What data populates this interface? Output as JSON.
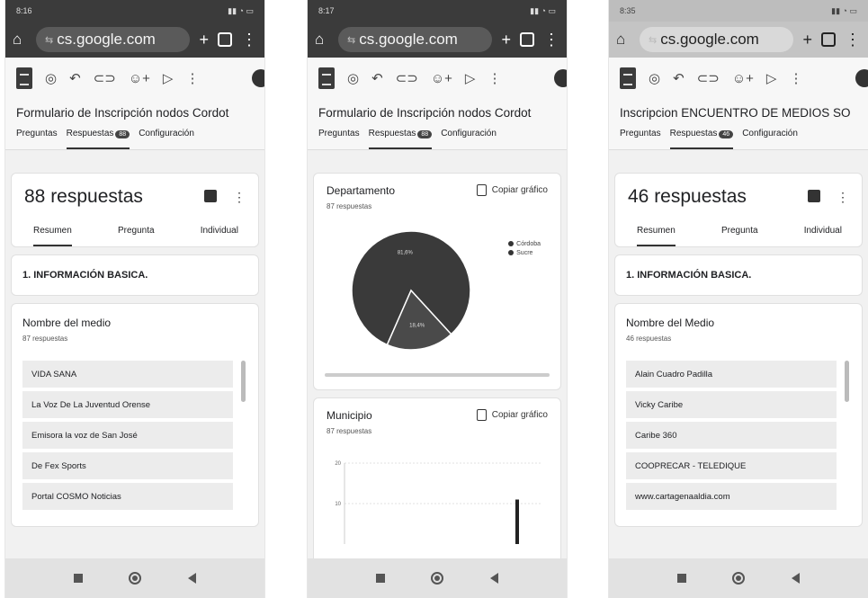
{
  "browser": {
    "url": "cs.google.com",
    "tune_glyph": "⇆"
  },
  "phones": [
    {
      "status_time": "8:16",
      "title": "Formulario de Inscripción  nodos Cordot",
      "tabs": {
        "preguntas": "Preguntas",
        "respuestas": "Respuestas",
        "badge": "88",
        "configuracion": "Configuración"
      },
      "summary": {
        "count_text": "88 respuestas",
        "resumen": "Resumen",
        "pregunta": "Pregunta",
        "individual": "Individual"
      },
      "section": "1. INFORMACIÓN BASICA.",
      "question": {
        "title": "Nombre del medio",
        "responses": "87 respuestas",
        "items": [
          "VIDA SANA",
          "La Voz De La Juventud Orense",
          "Emisora la voz de San José",
          "De Fex Sports",
          "Portal COSMO Noticias"
        ]
      }
    },
    {
      "status_time": "8:17",
      "title": "Formulario de Inscripción  nodos Cordot",
      "tabs": {
        "preguntas": "Preguntas",
        "respuestas": "Respuestas",
        "badge": "88",
        "configuracion": "Configuración"
      },
      "charts": [
        {
          "title": "Departamento",
          "responses": "87 respuestas",
          "copy": "Copiar gráfico"
        },
        {
          "title": "Municipio",
          "responses": "87 respuestas",
          "copy": "Copiar gráfico"
        }
      ]
    },
    {
      "status_time": "8:35",
      "title": "Inscripcion  ENCUENTRO DE MEDIOS SO",
      "tabs": {
        "preguntas": "Preguntas",
        "respuestas": "Respuestas",
        "badge": "46",
        "configuracion": "Configuración"
      },
      "summary": {
        "count_text": "46 respuestas",
        "resumen": "Resumen",
        "pregunta": "Pregunta",
        "individual": "Individual"
      },
      "section": "1. INFORMACIÓN BASICA.",
      "question": {
        "title": "Nombre del Medio",
        "responses": "46 respuestas",
        "items": [
          "Alain Cuadro Padilla",
          "Vicky Caribe",
          "Caribe 360",
          "COOPRECAR - TELEDIQUE",
          "www.cartagenaaldia.com"
        ]
      }
    }
  ],
  "chart_data": [
    {
      "type": "pie",
      "title": "Departamento",
      "categories": [
        "Córdoba",
        "Sucre"
      ],
      "values": [
        81.6,
        18.4
      ],
      "slice_labels": [
        "81,6%",
        "18,4%"
      ],
      "legend": "right"
    },
    {
      "type": "bar",
      "title": "Municipio",
      "ytick_labels": [
        "20",
        "10"
      ],
      "ylim": [
        0,
        20
      ],
      "values": [
        11
      ]
    }
  ]
}
